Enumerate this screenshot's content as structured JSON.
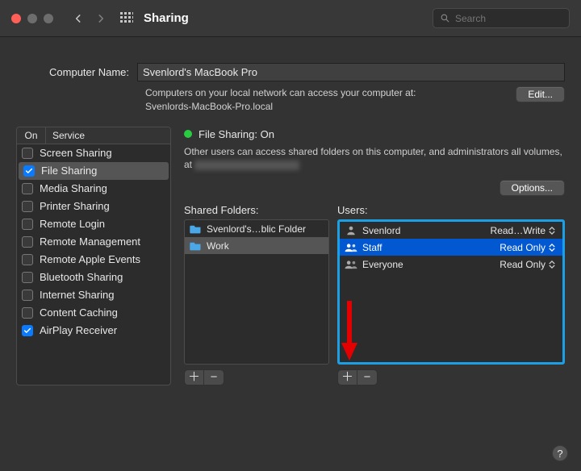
{
  "titlebar": {
    "title": "Sharing",
    "search_placeholder": "Search"
  },
  "computer_name": {
    "label": "Computer Name:",
    "value": "Svenlord's MacBook Pro",
    "sub1": "Computers on your local network can access your computer at:",
    "sub2": "Svenlords-MacBook-Pro.local",
    "edit": "Edit..."
  },
  "services": {
    "col_on": "On",
    "col_service": "Service",
    "items": [
      {
        "on": false,
        "label": "Screen Sharing"
      },
      {
        "on": true,
        "label": "File Sharing",
        "selected": true
      },
      {
        "on": false,
        "label": "Media Sharing"
      },
      {
        "on": false,
        "label": "Printer Sharing"
      },
      {
        "on": false,
        "label": "Remote Login"
      },
      {
        "on": false,
        "label": "Remote Management"
      },
      {
        "on": false,
        "label": "Remote Apple Events"
      },
      {
        "on": false,
        "label": "Bluetooth Sharing"
      },
      {
        "on": false,
        "label": "Internet Sharing"
      },
      {
        "on": false,
        "label": "Content Caching"
      },
      {
        "on": true,
        "label": "AirPlay Receiver"
      }
    ]
  },
  "right": {
    "status_title": "File Sharing: On",
    "status_desc": "Other users can access shared folders on this computer, and administrators all volumes, at ",
    "options": "Options...",
    "folders_label": "Shared Folders:",
    "users_label": "Users:",
    "folders": [
      {
        "name": "Svenlord's…blic Folder",
        "selected": false
      },
      {
        "name": "Work",
        "selected": true
      }
    ],
    "users": [
      {
        "name": "Svenlord",
        "perm": "Read…Write",
        "icon": "person"
      },
      {
        "name": "Staff",
        "perm": "Read Only",
        "icon": "people",
        "selected": true
      },
      {
        "name": "Everyone",
        "perm": "Read Only",
        "icon": "people"
      }
    ]
  },
  "help": "?"
}
